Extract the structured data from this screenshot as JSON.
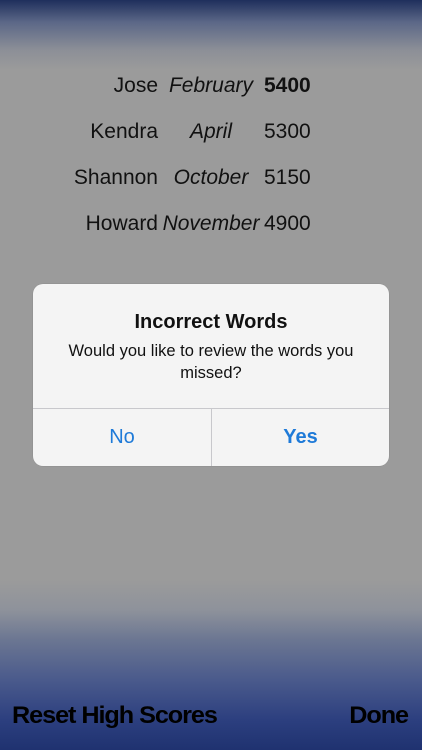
{
  "high_scores": [
    {
      "name": "Jose",
      "month": "February",
      "score": "5400"
    },
    {
      "name": "Kendra",
      "month": "April",
      "score": "5300"
    },
    {
      "name": "Shannon",
      "month": "October",
      "score": "5150"
    },
    {
      "name": "Howard",
      "month": "November",
      "score": "4900"
    }
  ],
  "alert": {
    "title": "Incorrect Words",
    "message": "Would you like to review the words you missed?",
    "no_label": "No",
    "yes_label": "Yes"
  },
  "toolbar": {
    "reset_label": "Reset High Scores",
    "done_label": "Done"
  },
  "colors": {
    "accent": "#1e7ad8",
    "toolbar_gradient": "#1f3270"
  }
}
